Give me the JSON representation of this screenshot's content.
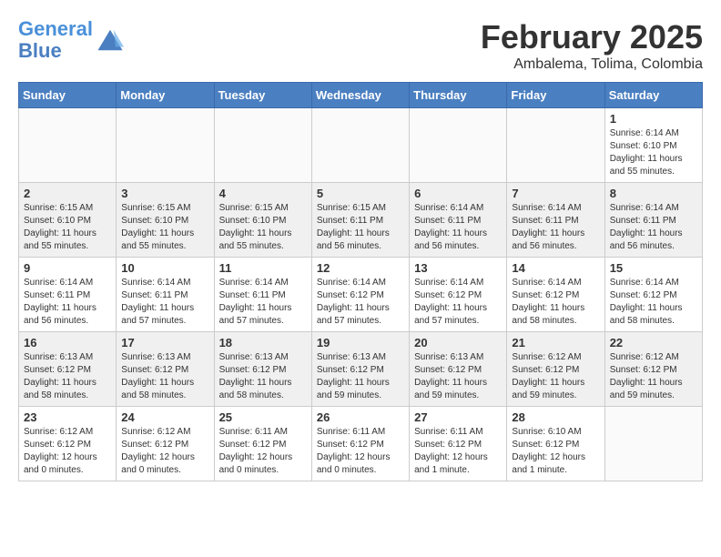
{
  "header": {
    "logo_line1": "General",
    "logo_line2": "Blue",
    "month_title": "February 2025",
    "location": "Ambalema, Tolima, Colombia"
  },
  "days_of_week": [
    "Sunday",
    "Monday",
    "Tuesday",
    "Wednesday",
    "Thursday",
    "Friday",
    "Saturday"
  ],
  "weeks": [
    {
      "days": [
        {
          "date": "",
          "info": ""
        },
        {
          "date": "",
          "info": ""
        },
        {
          "date": "",
          "info": ""
        },
        {
          "date": "",
          "info": ""
        },
        {
          "date": "",
          "info": ""
        },
        {
          "date": "",
          "info": ""
        },
        {
          "date": "1",
          "info": "Sunrise: 6:14 AM\nSunset: 6:10 PM\nDaylight: 11 hours\nand 55 minutes."
        }
      ]
    },
    {
      "days": [
        {
          "date": "2",
          "info": "Sunrise: 6:15 AM\nSunset: 6:10 PM\nDaylight: 11 hours\nand 55 minutes."
        },
        {
          "date": "3",
          "info": "Sunrise: 6:15 AM\nSunset: 6:10 PM\nDaylight: 11 hours\nand 55 minutes."
        },
        {
          "date": "4",
          "info": "Sunrise: 6:15 AM\nSunset: 6:10 PM\nDaylight: 11 hours\nand 55 minutes."
        },
        {
          "date": "5",
          "info": "Sunrise: 6:15 AM\nSunset: 6:11 PM\nDaylight: 11 hours\nand 56 minutes."
        },
        {
          "date": "6",
          "info": "Sunrise: 6:14 AM\nSunset: 6:11 PM\nDaylight: 11 hours\nand 56 minutes."
        },
        {
          "date": "7",
          "info": "Sunrise: 6:14 AM\nSunset: 6:11 PM\nDaylight: 11 hours\nand 56 minutes."
        },
        {
          "date": "8",
          "info": "Sunrise: 6:14 AM\nSunset: 6:11 PM\nDaylight: 11 hours\nand 56 minutes."
        }
      ]
    },
    {
      "days": [
        {
          "date": "9",
          "info": "Sunrise: 6:14 AM\nSunset: 6:11 PM\nDaylight: 11 hours\nand 56 minutes."
        },
        {
          "date": "10",
          "info": "Sunrise: 6:14 AM\nSunset: 6:11 PM\nDaylight: 11 hours\nand 57 minutes."
        },
        {
          "date": "11",
          "info": "Sunrise: 6:14 AM\nSunset: 6:11 PM\nDaylight: 11 hours\nand 57 minutes."
        },
        {
          "date": "12",
          "info": "Sunrise: 6:14 AM\nSunset: 6:12 PM\nDaylight: 11 hours\nand 57 minutes."
        },
        {
          "date": "13",
          "info": "Sunrise: 6:14 AM\nSunset: 6:12 PM\nDaylight: 11 hours\nand 57 minutes."
        },
        {
          "date": "14",
          "info": "Sunrise: 6:14 AM\nSunset: 6:12 PM\nDaylight: 11 hours\nand 58 minutes."
        },
        {
          "date": "15",
          "info": "Sunrise: 6:14 AM\nSunset: 6:12 PM\nDaylight: 11 hours\nand 58 minutes."
        }
      ]
    },
    {
      "days": [
        {
          "date": "16",
          "info": "Sunrise: 6:13 AM\nSunset: 6:12 PM\nDaylight: 11 hours\nand 58 minutes."
        },
        {
          "date": "17",
          "info": "Sunrise: 6:13 AM\nSunset: 6:12 PM\nDaylight: 11 hours\nand 58 minutes."
        },
        {
          "date": "18",
          "info": "Sunrise: 6:13 AM\nSunset: 6:12 PM\nDaylight: 11 hours\nand 58 minutes."
        },
        {
          "date": "19",
          "info": "Sunrise: 6:13 AM\nSunset: 6:12 PM\nDaylight: 11 hours\nand 59 minutes."
        },
        {
          "date": "20",
          "info": "Sunrise: 6:13 AM\nSunset: 6:12 PM\nDaylight: 11 hours\nand 59 minutes."
        },
        {
          "date": "21",
          "info": "Sunrise: 6:12 AM\nSunset: 6:12 PM\nDaylight: 11 hours\nand 59 minutes."
        },
        {
          "date": "22",
          "info": "Sunrise: 6:12 AM\nSunset: 6:12 PM\nDaylight: 11 hours\nand 59 minutes."
        }
      ]
    },
    {
      "days": [
        {
          "date": "23",
          "info": "Sunrise: 6:12 AM\nSunset: 6:12 PM\nDaylight: 12 hours\nand 0 minutes."
        },
        {
          "date": "24",
          "info": "Sunrise: 6:12 AM\nSunset: 6:12 PM\nDaylight: 12 hours\nand 0 minutes."
        },
        {
          "date": "25",
          "info": "Sunrise: 6:11 AM\nSunset: 6:12 PM\nDaylight: 12 hours\nand 0 minutes."
        },
        {
          "date": "26",
          "info": "Sunrise: 6:11 AM\nSunset: 6:12 PM\nDaylight: 12 hours\nand 0 minutes."
        },
        {
          "date": "27",
          "info": "Sunrise: 6:11 AM\nSunset: 6:12 PM\nDaylight: 12 hours\nand 1 minute."
        },
        {
          "date": "28",
          "info": "Sunrise: 6:10 AM\nSunset: 6:12 PM\nDaylight: 12 hours\nand 1 minute."
        },
        {
          "date": "",
          "info": ""
        }
      ]
    }
  ]
}
